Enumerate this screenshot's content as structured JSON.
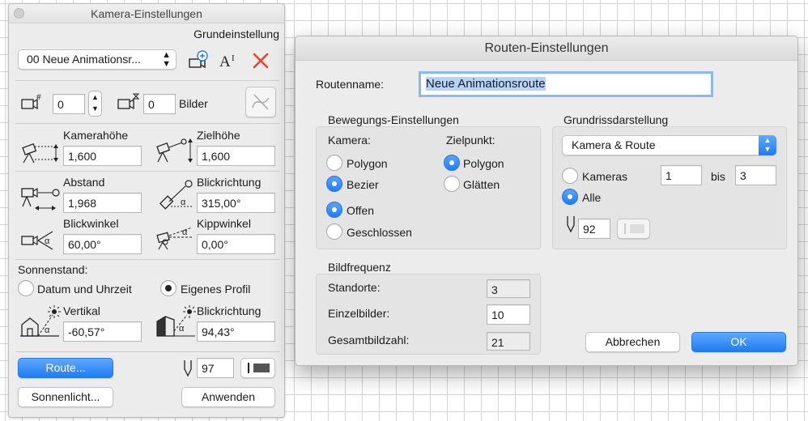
{
  "kamera": {
    "title": "Kamera-Einstellungen",
    "grundeinstellung": "Grundeinstellung",
    "animation_select": "00  Neue Animationsr...",
    "frame_value": "0",
    "frame_end_value": "0",
    "bilder_label": "Bilder",
    "kamerahoehe_label": "Kamerahöhe",
    "kamerahoehe_value": "1,600",
    "zielhoehe_label": "Zielhöhe",
    "zielhoehe_value": "1,600",
    "abstand_label": "Abstand",
    "abstand_value": "1,968",
    "blickrichtung_label": "Blickrichtung",
    "blickrichtung_value": "315,00°",
    "blickwinkel_label": "Blickwinkel",
    "blickwinkel_value": "60,00°",
    "kippwinkel_label": "Kippwinkel",
    "kippwinkel_value": "0,00°",
    "sonnenstand_label": "Sonnenstand:",
    "datum_label": "Datum und Uhrzeit",
    "profil_label": "Eigenes Profil",
    "vertikal_label": "Vertikal",
    "vertikal_value": "-60,57°",
    "sonne_blick_label": "Blickrichtung",
    "sonne_blick_value": "94,43°",
    "route_button": "Route...",
    "pen_value": "97",
    "sonnenlicht_button": "Sonnenlicht...",
    "anwenden_button": "Anwenden"
  },
  "route": {
    "title": "Routen-Einstellungen",
    "routenname_label": "Routenname:",
    "routenname_value": "Neue Animationsroute",
    "bewegung_title": "Bewegungs-Einstellungen",
    "kamera_label": "Kamera:",
    "polygon": "Polygon",
    "bezier": "Bezier",
    "zielpunkt_label": "Zielpunkt:",
    "zp_polygon": "Polygon",
    "glaetten": "Glätten",
    "offen": "Offen",
    "geschlossen": "Geschlossen",
    "grundriss_title": "Grundrissdarstellung",
    "grundriss_select": "Kamera & Route",
    "kameras_label": "Kameras",
    "kameras_from": "1",
    "bis_label": "bis",
    "kameras_to": "3",
    "alle_label": "Alle",
    "pen_value": "92",
    "bildfrequenz_title": "Bildfrequenz",
    "standorte_label": "Standorte:",
    "standorte_value": "3",
    "einzelbilder_label": "Einzelbilder:",
    "einzelbilder_value": "10",
    "gesamt_label": "Gesamtbildzahl:",
    "gesamt_value": "21",
    "abbrechen_button": "Abbrechen",
    "ok_button": "OK"
  },
  "colors": {
    "accent": "#1f7cf2",
    "close_x": "#e8432e",
    "panel_bg": "#ececec"
  }
}
